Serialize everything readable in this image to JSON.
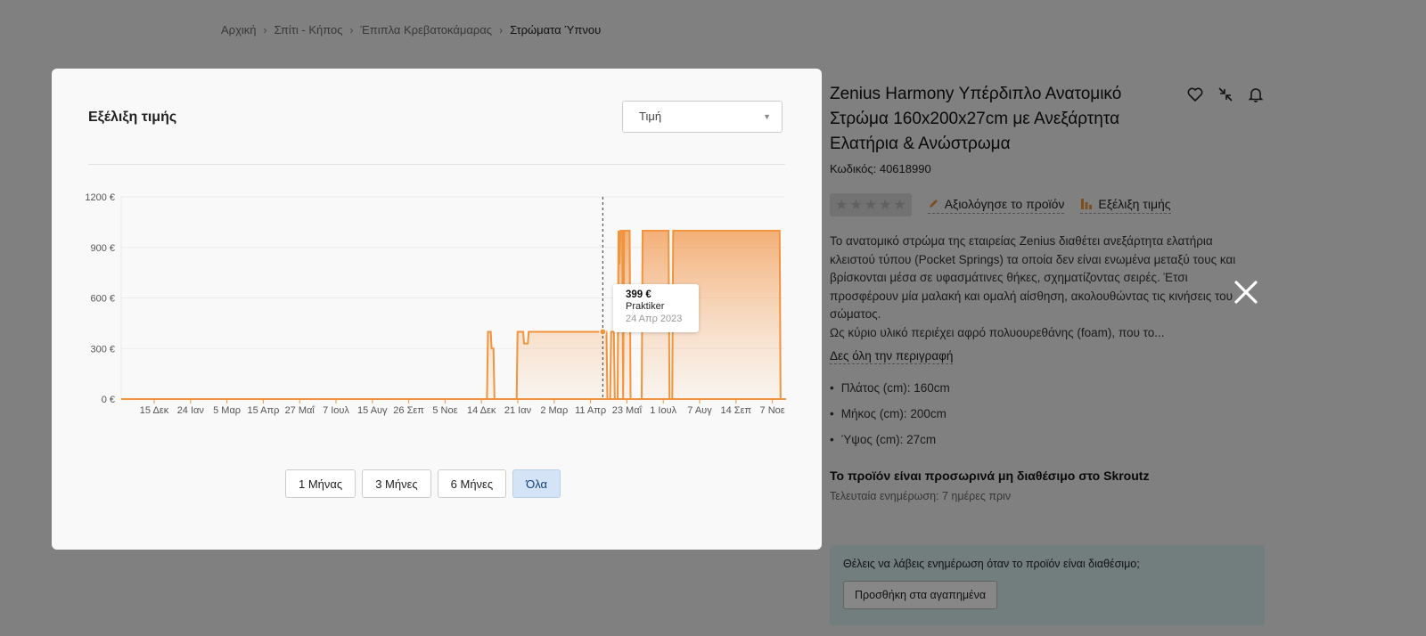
{
  "breadcrumb": [
    "Αρχική",
    "Σπίτι - Κήπος",
    "Έπιπλα Κρεβατοκάμαρας",
    "Στρώματα Ύπνου"
  ],
  "product": {
    "title": "Zenius Harmony Υπέρδιπλο Ανατομικό Στρώμα 160x200x27cm με Ανεξάρτητα Ελατήρια & Ανώστρωμα",
    "code": "Κωδικός: 40618990",
    "rate_label": "Αξιολόγησε το προϊόν",
    "history_label": "Εξέλιξη τιμής",
    "description": "Το ανατομικό στρώμα της εταιρείας Zenius διαθέτει ανεξάρτητα ελατήρια κλειστού τύπου (Pocket Springs) τα οποία δεν είναι ενωμένα μεταξύ τους και βρίσκονται μέσα σε υφασμάτινες θήκες, σχηματίζοντας σειρές. Έτσι προσφέρουν μία μαλακή και ομαλή αίσθηση, ακολουθώντας τις κινήσεις του σώματος.",
    "description_2": "Ως κύριο υλικό περιέχει αφρό πολυουρεθάνης (foam), που το...",
    "more_label": "Δες όλη την περιγραφή",
    "specs": [
      "Πλάτος (cm): 160cm",
      "Μήκος (cm): 200cm",
      "Ύψος (cm): 27cm"
    ],
    "unavailable": "Το προϊόν είναι προσωρινά μη διαθέσιμο στο Skroutz",
    "updated": "Τελευταία ενημέρωση: 7 ημέρες πριν",
    "notify_text": "Θέλεις να λάβεις ενημέρωση όταν το προϊόν είναι διαθέσιμο;",
    "notify_button": "Προσθήκη στα αγαπημένα"
  },
  "modal": {
    "title": "Εξέλιξη τιμής",
    "select_value": "Τιμή",
    "ranges": [
      "1 Μήνας",
      "3 Μήνες",
      "6 Μήνες",
      "Όλα"
    ],
    "active_range": "Όλα",
    "tooltip": {
      "price": "399 €",
      "shop": "Praktiker",
      "date": "24 Απρ 2023"
    }
  },
  "colors": {
    "accent": "#f0943d",
    "active_range_bg": "#d4e4f6"
  },
  "chart_data": {
    "type": "area",
    "y_ticks": [
      "1200 €",
      "900 €",
      "600 €",
      "300 €",
      "0 €"
    ],
    "ylim": [
      0,
      1200
    ],
    "x_ticks": [
      "15 Δεκ",
      "24 Ιαν",
      "5 Μαρ",
      "15 Απρ",
      "27 Μαΐ",
      "7 Ιουλ",
      "15 Αυγ",
      "26 Σεπ",
      "5 Νοε",
      "14 Δεκ",
      "21 Ιαν",
      "2 Μαρ",
      "11 Απρ",
      "23 Μαΐ",
      "1 Ιουλ",
      "7 Αυγ",
      "14 Σεπ",
      "7 Νοε"
    ],
    "grid": true,
    "series": [
      {
        "points": [
          [
            "2021-11-20",
            0
          ],
          [
            "2022-12-20",
            0
          ],
          [
            "2022-12-21",
            399
          ],
          [
            "2022-12-24",
            399
          ],
          [
            "2022-12-25",
            300
          ],
          [
            "2022-12-27",
            300
          ],
          [
            "2022-12-28",
            0
          ],
          [
            "2023-01-21",
            0
          ],
          [
            "2023-01-22",
            399
          ],
          [
            "2023-01-28",
            399
          ],
          [
            "2023-01-29",
            330
          ],
          [
            "2023-02-02",
            330
          ],
          [
            "2023-02-03",
            399
          ],
          [
            "2023-04-28",
            399
          ],
          [
            "2023-04-29",
            0
          ],
          [
            "2023-05-02",
            0
          ],
          [
            "2023-05-03",
            399
          ],
          [
            "2023-05-06",
            399
          ],
          [
            "2023-05-07",
            0
          ],
          [
            "2023-05-10",
            0
          ],
          [
            "2023-05-11",
            999
          ],
          [
            "2023-05-12",
            800
          ],
          [
            "2023-05-13",
            999
          ],
          [
            "2023-05-15",
            999
          ],
          [
            "2023-05-16",
            0
          ],
          [
            "2023-05-17",
            999
          ],
          [
            "2023-05-23",
            999
          ],
          [
            "2023-05-24",
            0
          ],
          [
            "2023-06-05",
            0
          ],
          [
            "2023-06-06",
            999
          ],
          [
            "2023-07-04",
            999
          ],
          [
            "2023-07-05",
            0
          ],
          [
            "2023-07-08",
            0
          ],
          [
            "2023-07-09",
            999
          ],
          [
            "2023-11-01",
            999
          ],
          [
            "2023-11-02",
            0
          ],
          [
            "2023-11-06",
            0
          ]
        ]
      }
    ],
    "highlight": {
      "x": "2023-04-24",
      "y": 399
    }
  }
}
